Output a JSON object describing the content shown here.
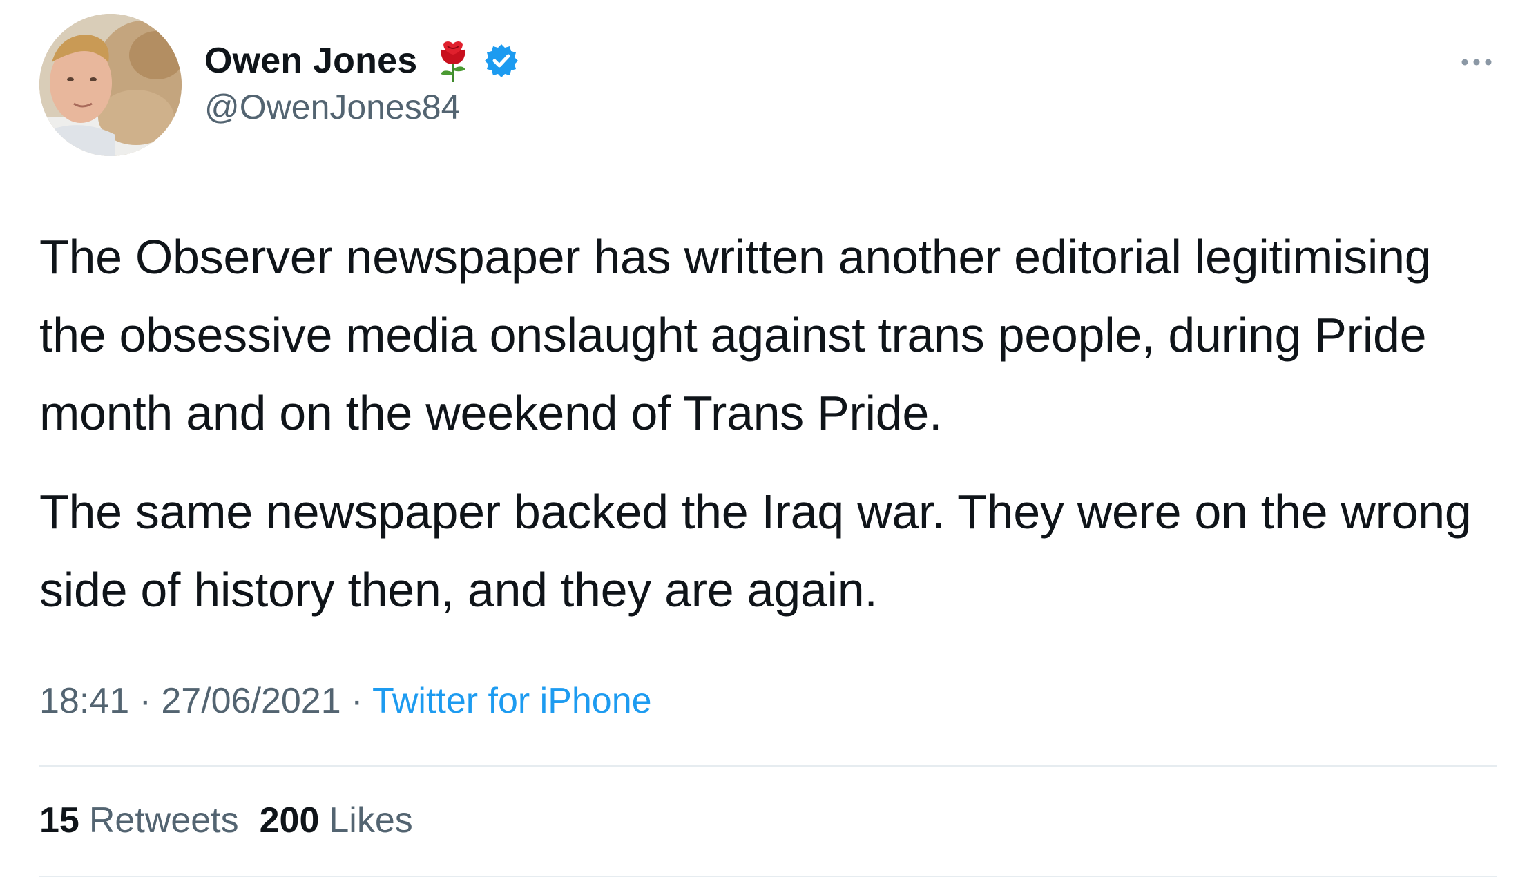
{
  "tweet": {
    "author": {
      "display_name": "Owen Jones",
      "handle": "@OwenJones84",
      "emoji": "rose-icon",
      "verified": true,
      "verified_color": "#1d9bf0"
    },
    "paragraphs": [
      "The Observer newspaper has written another editorial legitimising the obsessive media onslaught against trans people, during Pride month and on the weekend of Trans Pride.",
      "The same newspaper backed the Iraq war. They were on the wrong side of history then, and they are again."
    ],
    "time": "18:41",
    "date": "27/06/2021",
    "separator": "·",
    "source": "Twitter for iPhone",
    "stats": {
      "retweets_count": "15",
      "retweets_label": "Retweets",
      "likes_count": "200",
      "likes_label": "Likes"
    }
  },
  "colors": {
    "text_primary": "#0f1419",
    "text_secondary": "#536471",
    "link": "#1d9bf0"
  }
}
